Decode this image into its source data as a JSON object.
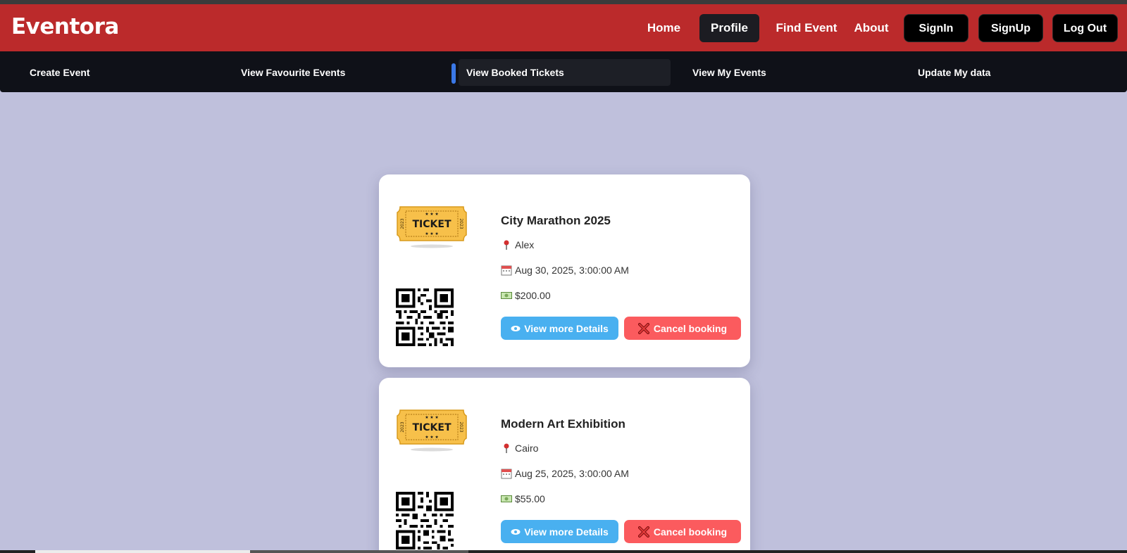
{
  "brand": "Eventora",
  "nav": {
    "home": "Home",
    "profile": "Profile",
    "find_event": "Find Event",
    "about": "About",
    "signin": "SignIn",
    "signup": "SignUp",
    "logout": "Log Out"
  },
  "subnav": {
    "items": [
      {
        "label": "Create Event"
      },
      {
        "label": "View Favourite Events"
      },
      {
        "label": "View Booked Tickets",
        "active": true
      },
      {
        "label": "View My Events"
      },
      {
        "label": "Update My data"
      }
    ]
  },
  "tickets": [
    {
      "title": "City Marathon 2025",
      "location": "Alex",
      "date": "Aug 30, 2025, 3:00:00 AM",
      "price": "$200.00",
      "details_label": "View more Details",
      "cancel_label": "Cancel booking"
    },
    {
      "title": "Modern Art Exhibition",
      "location": "Cairo",
      "date": "Aug 25, 2025, 3:00:00 AM",
      "price": "$55.00",
      "details_label": "View more Details",
      "cancel_label": "Cancel booking"
    }
  ],
  "ticket_image": {
    "text": "TICKET",
    "year": "2023"
  },
  "colors": {
    "navbar": "#bb2a2b",
    "subnav": "#0f1118",
    "background": "#bfc0dc",
    "details_button": "#49b0f0",
    "cancel_button": "#fb5b5e",
    "active_indicator": "#3a78e7"
  },
  "icons": {
    "location": "pin-icon",
    "date": "calendar-icon",
    "price": "money-icon",
    "details": "eye-icon",
    "cancel": "cross-icon"
  }
}
